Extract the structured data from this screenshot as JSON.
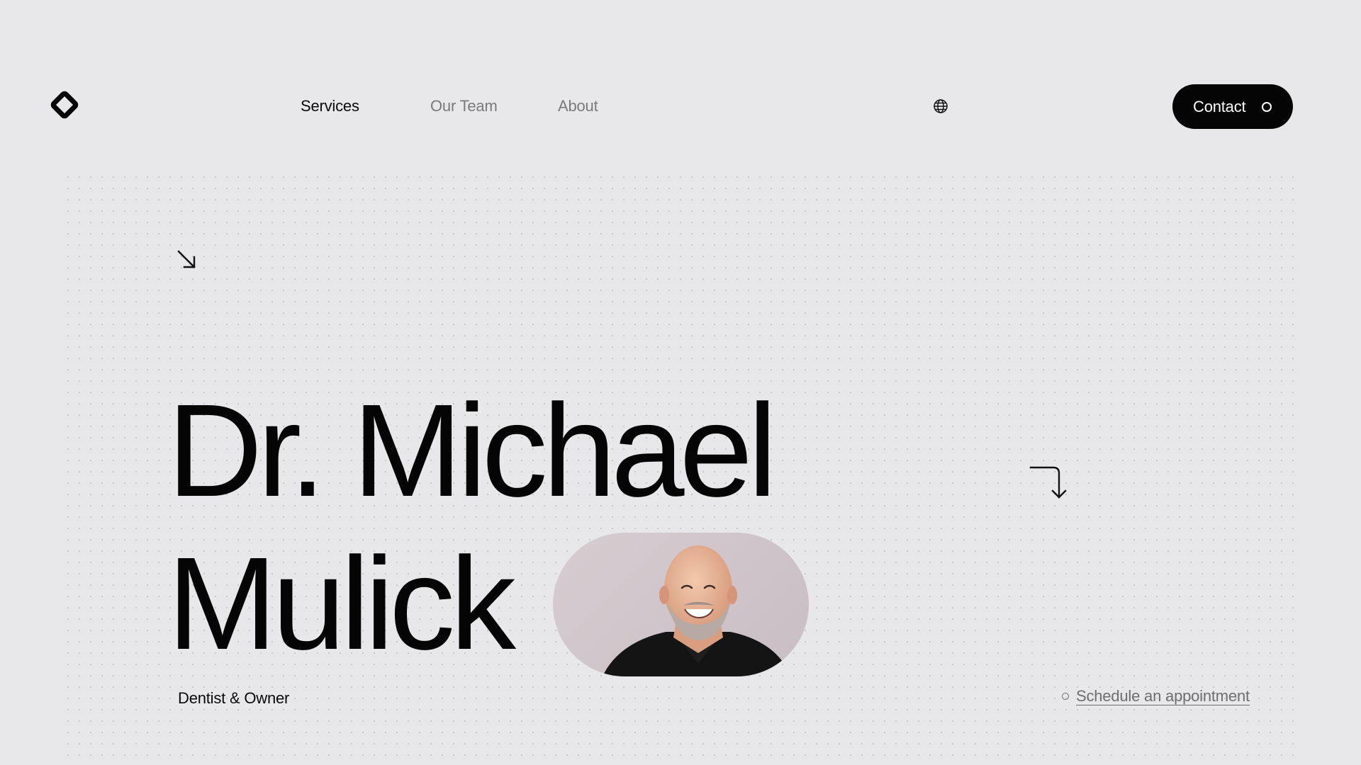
{
  "nav": {
    "logo_icon": "diamond-logo-icon",
    "links": [
      {
        "label": "Services",
        "active": true
      },
      {
        "label": "Our Team",
        "active": false
      },
      {
        "label": "About",
        "active": false
      }
    ],
    "language_icon": "globe-icon",
    "contact_label": "Contact"
  },
  "hero": {
    "name_line1": "Dr. Michael",
    "name_line2": "Mulick",
    "role": "Dentist & Owner",
    "portrait_icon": "portrait-photo",
    "arrow_icons": [
      "arrow-down-right-icon",
      "arrow-turn-down-icon"
    ],
    "schedule_label": "Schedule an appointment"
  },
  "colors": {
    "background": "#e8e8ea",
    "text": "#050505",
    "muted": "#7a7a7c",
    "button": "#050505",
    "button_text": "#ffffff"
  }
}
